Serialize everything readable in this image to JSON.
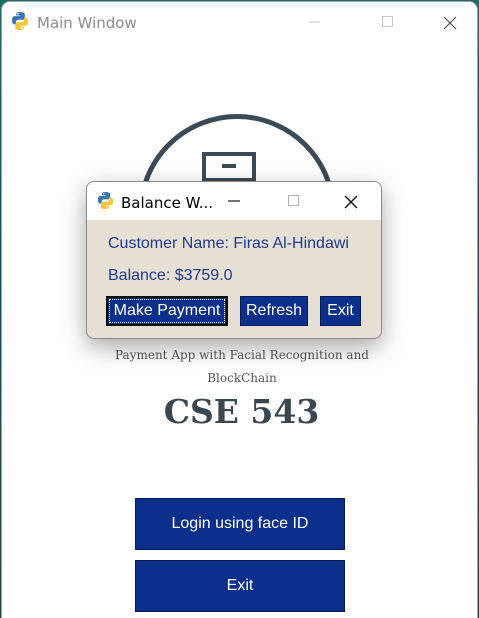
{
  "main_window": {
    "title": "Main Window",
    "subtitle": "Payment App with Facial Recognition and BlockChain",
    "heading": "CSE 543",
    "login_button": "Login using face ID",
    "exit_button": "Exit"
  },
  "balance_window": {
    "title": "Balance W...",
    "customer_name_label": "Customer Name: Firas Al-Hindawi",
    "balance_label": "Balance: $3759.0",
    "buttons": {
      "make_payment": "Make Payment",
      "refresh": "Refresh",
      "exit": "Exit"
    }
  },
  "icons": {
    "app_icon": "python-icon",
    "minimize": "minimize-icon",
    "maximize": "maximize-icon",
    "close": "close-icon",
    "logo": "cabinet-icon"
  },
  "colors": {
    "button_bg": "#0b2f8a",
    "label_text": "#1f3a8f",
    "popup_bg": "#e5dfd4"
  }
}
